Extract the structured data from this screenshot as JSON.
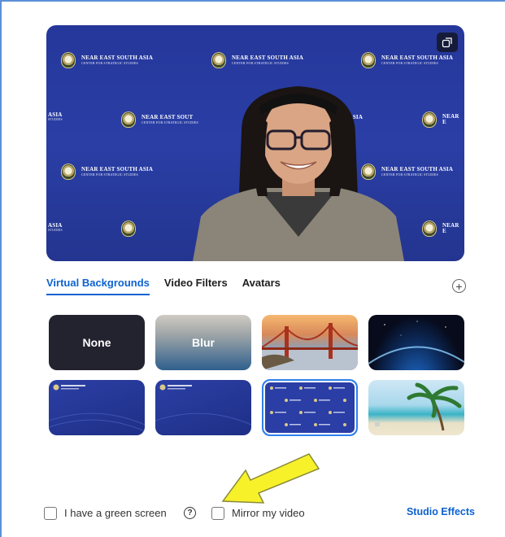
{
  "preview": {
    "backdrop_line1": "NEAR EAST SOUTH ASIA",
    "backdrop_line2": "CENTER FOR STRATEGIC STUDIES",
    "backdrop_short": "ASIA",
    "backdrop_short2": "STUDIES",
    "backdrop_partial": "NEAR EAST SOUT",
    "backdrop_near": "NEAR E"
  },
  "tabs": [
    {
      "label": "Virtual Backgrounds",
      "active": true
    },
    {
      "label": "Video Filters",
      "active": false
    },
    {
      "label": "Avatars",
      "active": false
    }
  ],
  "thumbnails": {
    "none_label": "None",
    "blur_label": "Blur",
    "bridge": "golden-gate-bridge",
    "earth": "earth-from-space",
    "nesa1": "nesa-blue-slide",
    "nesa2": "nesa-blue-slide-2",
    "nesa3": "nesa-pattern-selected",
    "beach": "beach-palm"
  },
  "footer": {
    "green_screen_label": "I have a green screen",
    "mirror_label": "Mirror my video",
    "studio_label": "Studio Effects"
  },
  "colors": {
    "accent": "#0e62d0",
    "backdrop": "#2a3ea6",
    "arrow": "#f7f12a"
  }
}
